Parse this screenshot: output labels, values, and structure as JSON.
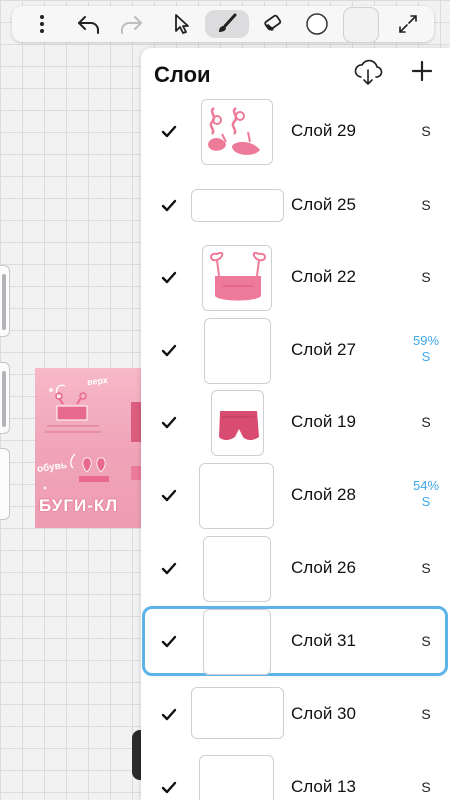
{
  "toolbar": {
    "menu_icon": "more-vertical-icon",
    "undo_icon": "undo-icon",
    "redo_icon": "redo-icon",
    "select_icon": "cursor-arrow-icon",
    "brush_icon": "brush-icon",
    "eraser_icon": "eraser-icon",
    "color_icon": "color-circle-icon",
    "fullscreen_icon": "expand-arrows-icon"
  },
  "artwork": {
    "label_top": "верх",
    "label_mid": "обувь",
    "logo_text": "БУГИ-КЛ"
  },
  "panel": {
    "title": "Слои",
    "upload_icon": "cloud-download-icon",
    "add_icon": "plus-icon"
  },
  "layers": [
    {
      "name": "Слой 29",
      "blend": "S",
      "visible": true,
      "selected": false
    },
    {
      "name": "Слой 25",
      "blend": "S",
      "visible": true,
      "selected": false
    },
    {
      "name": "Слой 22",
      "blend": "S",
      "visible": true,
      "selected": false
    },
    {
      "name": "Слой 27",
      "blend": "S",
      "opacity": "59%",
      "visible": true,
      "selected": false
    },
    {
      "name": "Слой 19",
      "blend": "S",
      "visible": true,
      "selected": false
    },
    {
      "name": "Слой 28",
      "blend": "S",
      "opacity": "54%",
      "visible": true,
      "selected": false
    },
    {
      "name": "Слой 26",
      "blend": "S",
      "visible": true,
      "selected": false
    },
    {
      "name": "Слой 31",
      "blend": "S",
      "visible": true,
      "selected": true
    },
    {
      "name": "Слой 30",
      "blend": "S",
      "visible": true,
      "selected": false
    },
    {
      "name": "Слой 13",
      "blend": "S",
      "visible": true,
      "selected": false
    }
  ],
  "colors": {
    "accent_blue": "#5bb3e8",
    "opacity_blue": "#3ea7e8",
    "art_pink": "#f0a3b8",
    "art_dark_pink": "#e36d8c"
  }
}
